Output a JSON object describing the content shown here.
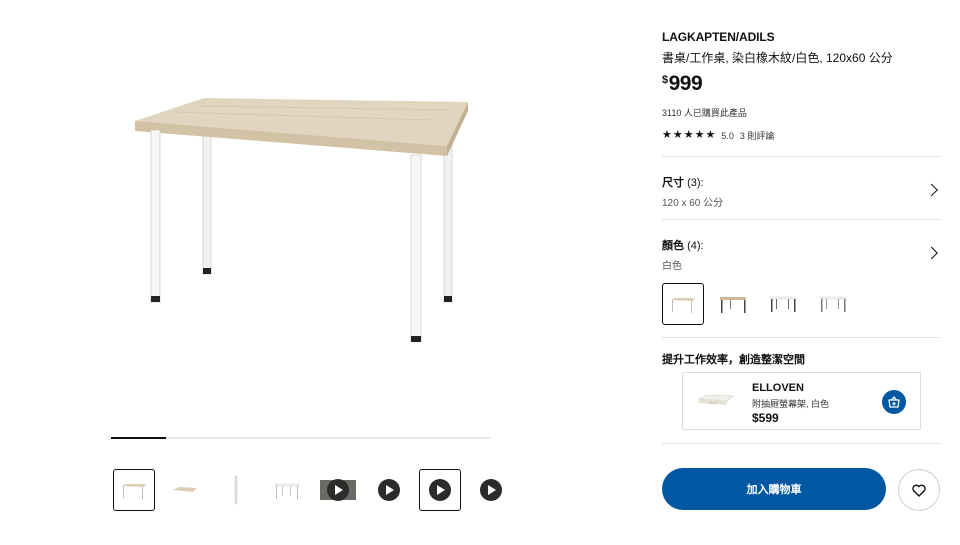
{
  "product": {
    "name": "LAGKAPTEN/ADILS",
    "description": "書桌/工作桌, 染白橡木紋/白色, 120x60 公分",
    "currency_symbol": "$",
    "price": "999",
    "purchased_text": "3110 人已購買此產品",
    "rating_score": "5.0",
    "reviews_text": "3 則評論",
    "stars": 5
  },
  "gallery": {
    "progress_fraction": 0.145,
    "thumbnails": [
      "table-oak-white",
      "table-tabletop",
      "table-leg",
      "table-white",
      "video-1",
      "video-2",
      "video-3",
      "video-4"
    ],
    "selected_index": 0
  },
  "size": {
    "label": "尺寸",
    "count": "(3):",
    "value": "120 x 60 公分"
  },
  "color": {
    "label": "顏色",
    "count": "(4):",
    "value": "白色",
    "swatches": [
      "oak-white",
      "oak-dark",
      "white-black",
      "white"
    ],
    "selected_index": 0
  },
  "promo": {
    "title": "提升工作效率，創造整潔空間",
    "item_name": "ELLOVEN",
    "item_desc": "附抽屜螢幕架, 白色",
    "item_price": "$599"
  },
  "actions": {
    "add_to_cart": "加入購物車"
  },
  "colors": {
    "accent": "#0058a3",
    "tabletop": "#dccdb4",
    "leg": "#f4f4f2"
  }
}
